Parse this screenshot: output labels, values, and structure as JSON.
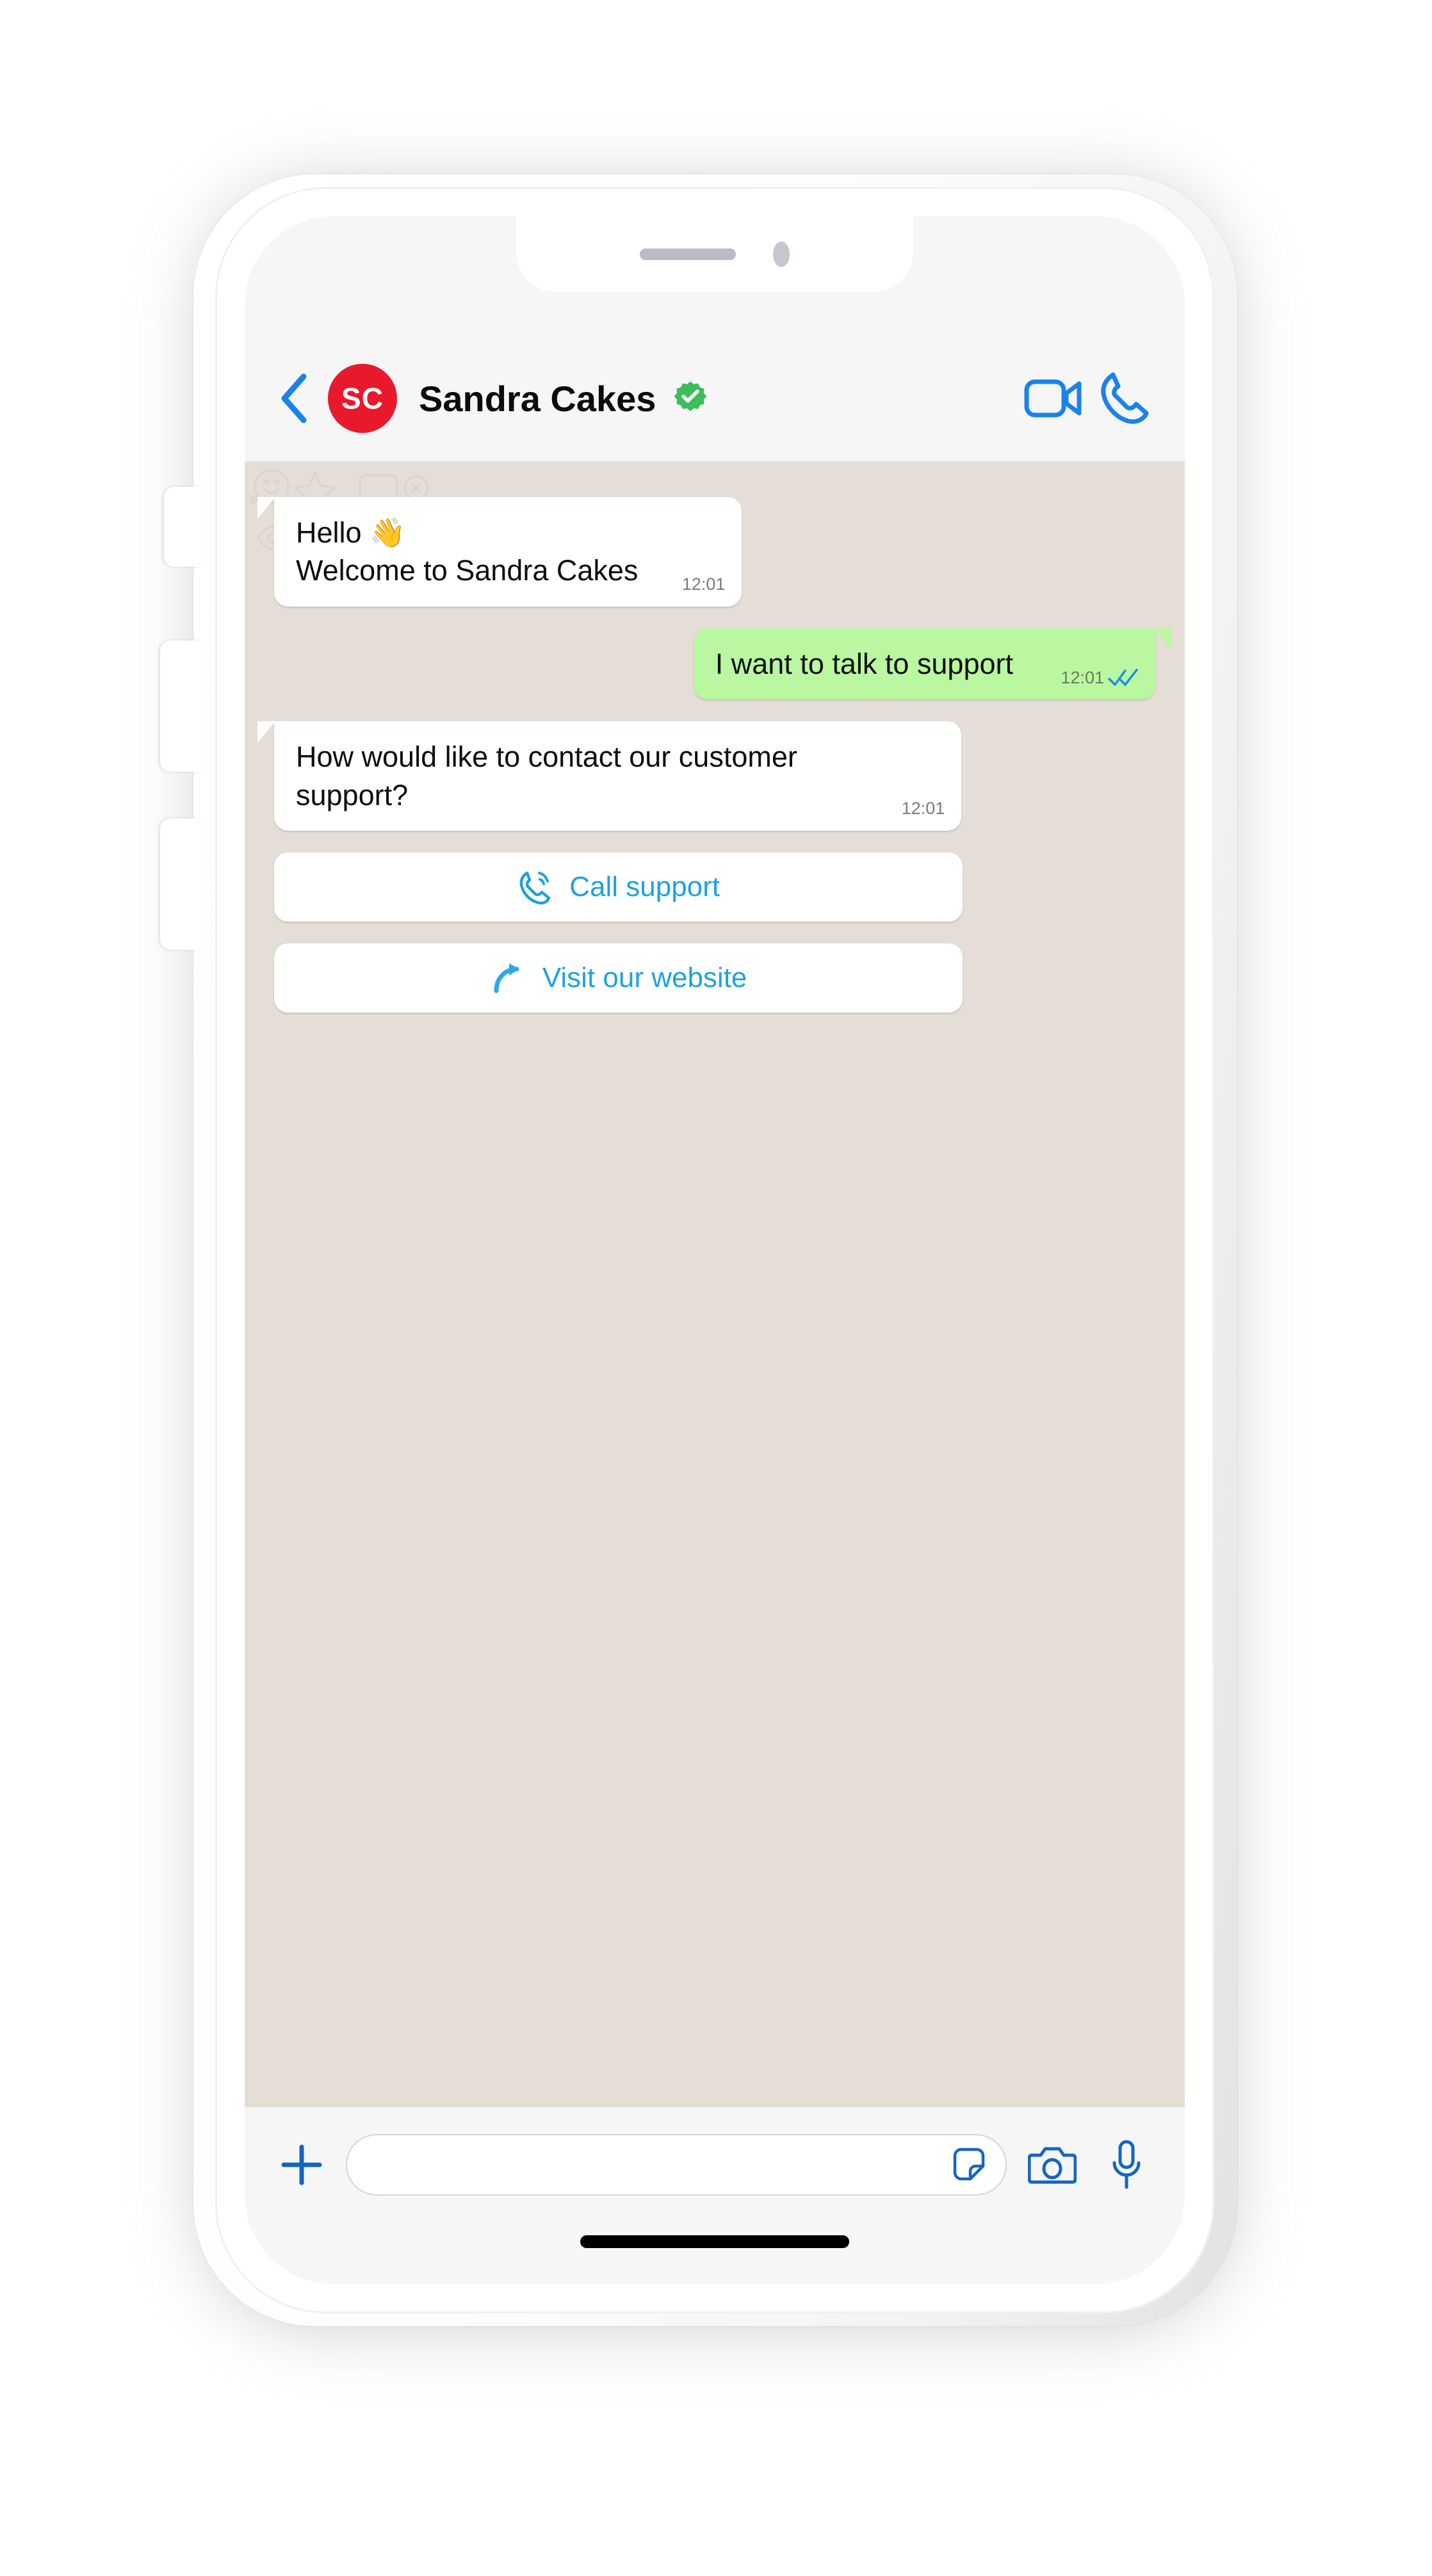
{
  "device": {
    "type": "white-smartphone-mockup",
    "notch": {
      "speaker": "earpiece-speaker",
      "camera": "front-camera"
    },
    "side_buttons": [
      "silent-switch",
      "volume-up",
      "volume-down"
    ],
    "home_indicator": true
  },
  "header": {
    "back_icon": "chevron-left-icon",
    "avatar_initials": "SC",
    "avatar_color": "#E8192C",
    "contact_name": "Sandra Cakes",
    "verified_badge": "verified-check-icon",
    "verified_color": "#3DBD5C",
    "video_call_icon": "video-camera-icon",
    "voice_call_icon": "phone-handset-icon",
    "accent_color": "#1A82EB"
  },
  "chat": {
    "wallpaper": "whatsapp-doodle-pattern",
    "wallpaper_color": "#E5DED7",
    "incoming_bubble_color": "#FFFFFF",
    "outgoing_bubble_color": "#B9F8A0",
    "messages": [
      {
        "direction": "in",
        "text": "Hello 👋\nWelcome to Sandra Cakes",
        "time": "12:01",
        "status": ""
      },
      {
        "direction": "out",
        "text": "I want to talk to support",
        "time": "12:01",
        "status": "read"
      },
      {
        "direction": "in",
        "text": "How would like to contact our customer support?",
        "time": "12:01",
        "status": ""
      }
    ],
    "quick_replies": [
      {
        "label": "Call support",
        "icon": "phone-call-icon"
      },
      {
        "label": "Visit our website",
        "icon": "curved-arrow-icon"
      }
    ],
    "quick_reply_color": "#1FA2DD"
  },
  "input_bar": {
    "attach_icon": "plus-icon",
    "placeholder": "",
    "value": "",
    "sticker_icon": "sticker-icon",
    "camera_icon": "camera-icon",
    "mic_icon": "microphone-icon",
    "accent_color": "#1565C0"
  }
}
